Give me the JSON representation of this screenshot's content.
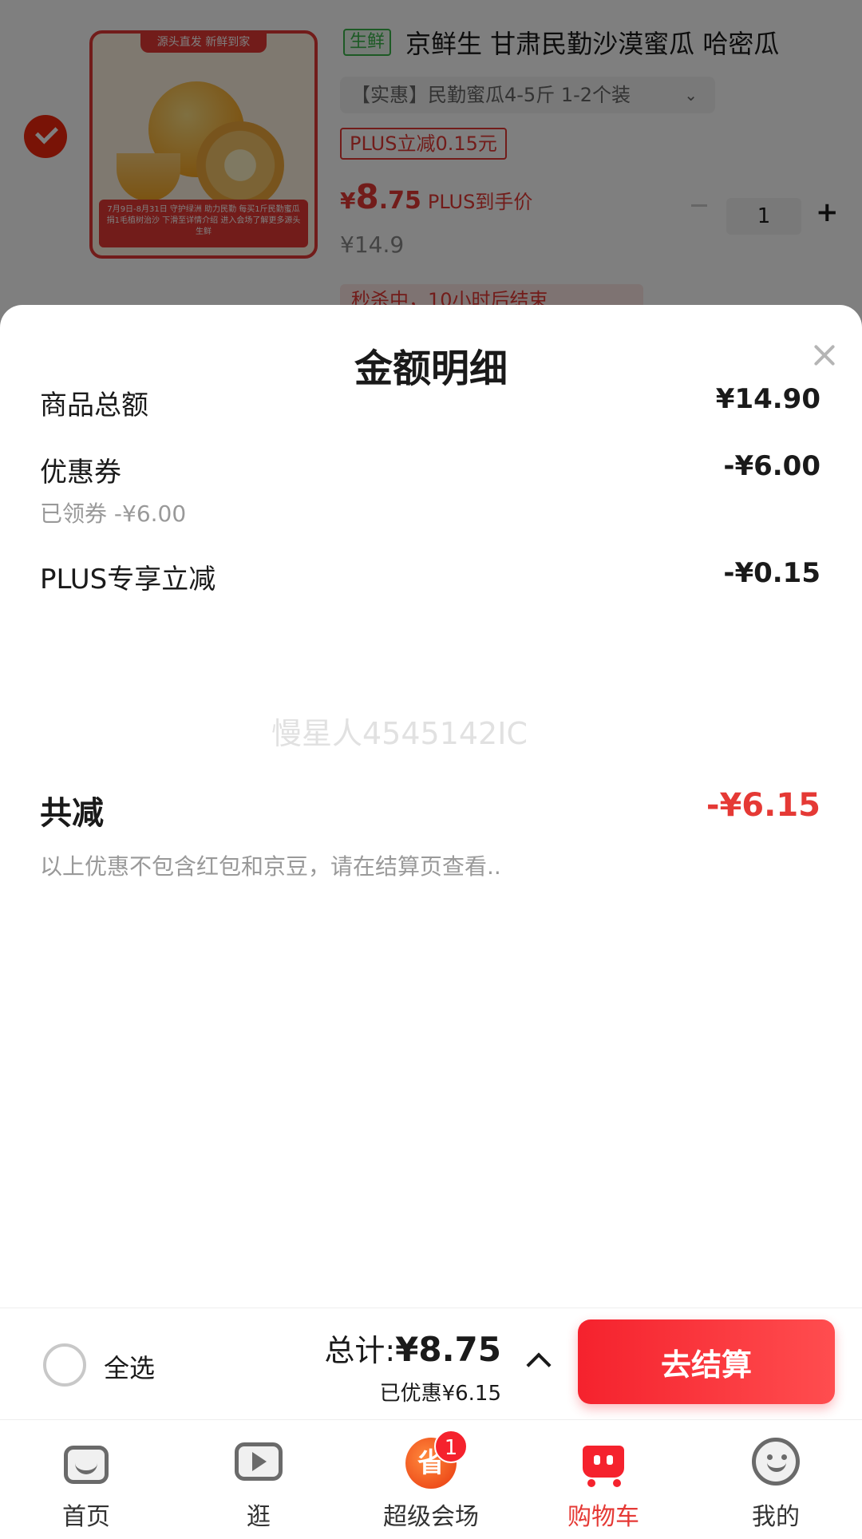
{
  "cart_item": {
    "image_banner": "源头直发  新鲜到家",
    "image_footer": "7月9日-8月31日 守护绿洲 助力民勤  每买1斤民勤蜜瓜捐1毛植树治沙  下滑至详情介绍 进入会场了解更多源头生鲜",
    "fresh_tag": "生鲜",
    "title": "京鲜生 甘肃民勤沙漠蜜瓜 哈密瓜",
    "variant": "【实惠】民勤蜜瓜4-5斤 1-2个装",
    "plus_tag": "PLUS立减0.15元",
    "price_symbol": "¥",
    "price_int": "8",
    "price_dec": ".75",
    "price_note": "PLUS到手价",
    "original_price": "¥14.9",
    "quantity": "1",
    "seckill": "秒杀中，10小时后结束"
  },
  "sheet": {
    "title": "金额明细",
    "rows": [
      {
        "label": "商品总额",
        "value": "¥14.90"
      },
      {
        "label": "优惠券",
        "value": "-¥6.00",
        "sub": "已领券 -¥6.00"
      },
      {
        "label": "PLUS专享立减",
        "value": "-¥0.15"
      }
    ],
    "watermark": "慢星人4545142IC",
    "total_label": "共减",
    "total_value": "-¥6.15",
    "footnote": "以上优惠不包含红包和京豆，请在结算页查看.."
  },
  "checkout": {
    "select_all": "全选",
    "total_label": "总计:",
    "total_value": "¥8.75",
    "saved": "已优惠¥6.15",
    "button": "去结算"
  },
  "nav": {
    "items": [
      {
        "label": "首页",
        "icon": "home-icon"
      },
      {
        "label": "逛",
        "icon": "video-icon"
      },
      {
        "label": "超级会场",
        "icon": "super-venue-icon",
        "badge": "1",
        "glyph": "省"
      },
      {
        "label": "购物车",
        "icon": "cart-icon",
        "active": true
      },
      {
        "label": "我的",
        "icon": "profile-icon"
      }
    ]
  },
  "colors": {
    "accent": "#f2270c",
    "price_red": "#e53935",
    "fresh_green": "#3ab54a"
  }
}
